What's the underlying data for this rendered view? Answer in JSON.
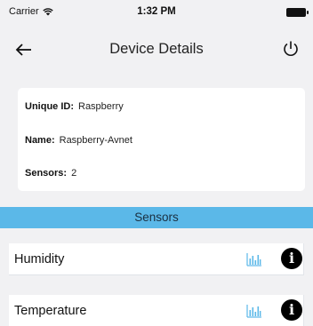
{
  "status_bar": {
    "carrier": "Carrier",
    "time": "1:32 PM",
    "icons": [
      "wifi-icon",
      "battery-icon"
    ]
  },
  "nav": {
    "title": "Device Details",
    "icons": [
      "back-arrow-icon",
      "power-icon"
    ]
  },
  "device": {
    "unique_id_label": "Unique ID:",
    "unique_id": "Raspberry",
    "name_label": "Name:",
    "name": "Raspberry-Avnet",
    "sensors_label": "Sensors:",
    "sensors_count": "2"
  },
  "sensors_section": {
    "header": "Sensors",
    "items": [
      {
        "label": "Humidity"
      },
      {
        "label": "Temperature"
      }
    ],
    "chart_icon_color": "#5bb8e8",
    "info_icon_glyph": "i"
  },
  "colors": {
    "background": "#f1f1f3",
    "accent": "#5bb8e8"
  }
}
